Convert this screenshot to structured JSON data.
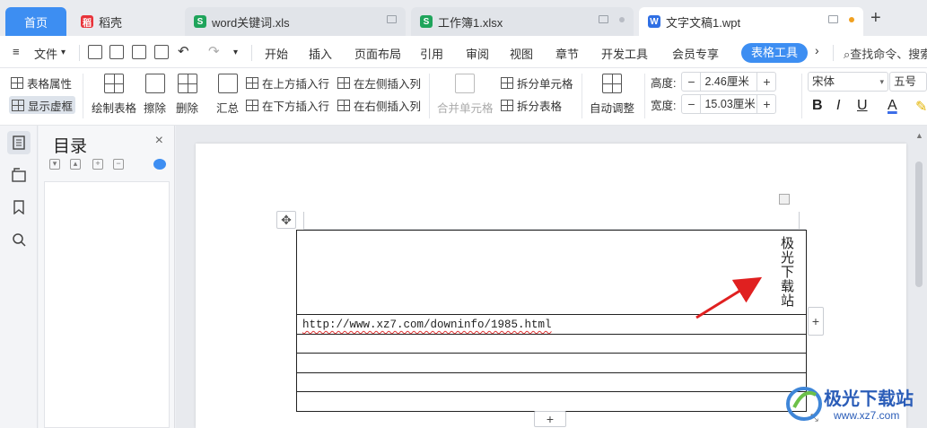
{
  "tabs": [
    {
      "label": "首页"
    },
    {
      "label": "稻壳",
      "icon": "wps-docer-icon"
    },
    {
      "label": "word关键词.xls",
      "icon": "spreadsheet-icon"
    },
    {
      "label": "工作簿1.xlsx",
      "icon": "spreadsheet-icon"
    },
    {
      "label": "文字文稿1.wpt",
      "icon": "writer-icon"
    }
  ],
  "icon_glyphs": {
    "docer": "稻",
    "sheet": "S",
    "writer": "W"
  },
  "new_tab_glyph": "+",
  "menu": {
    "file": "文件",
    "items": [
      "开始",
      "插入",
      "页面布局",
      "引用",
      "审阅",
      "视图",
      "章节",
      "开发工具",
      "会员专享"
    ],
    "table_tools": "表格工具",
    "search_placeholder": "查找命令、搜索"
  },
  "ribbon": {
    "table_props": "表格属性",
    "show_grid": "显示虚框",
    "draw_table": "绘制表格",
    "erase": "擦除",
    "delete": "删除",
    "summary": "汇总",
    "insert_above": "在上方插入行",
    "insert_below": "在下方插入行",
    "insert_left": "在左侧插入列",
    "insert_right": "在右侧插入列",
    "merge_cells": "合并单元格",
    "split_cells": "拆分单元格",
    "split_table": "拆分表格",
    "auto_adjust": "自动调整",
    "height_label": "高度:",
    "height_value": "2.46厘米",
    "width_label": "宽度:",
    "width_value": "15.03厘米",
    "font_name": "宋体",
    "font_size": "五号",
    "bold": "B",
    "italic": "I",
    "underline": "U",
    "font_color": "A",
    "minus": "−",
    "plus": "+"
  },
  "toc": {
    "title": "目录",
    "close": "×"
  },
  "document": {
    "vertical_text": "极光下载站",
    "url": "http://www.xz7.com/downinfo/1985.html",
    "empty_rows": 4
  },
  "watermark": {
    "name": "极光下载站",
    "url": "www.xz7.com"
  },
  "colors": {
    "accent": "#3d8ef2",
    "annotation_arrow": "#e02020",
    "watermark": "#2b5db8"
  }
}
